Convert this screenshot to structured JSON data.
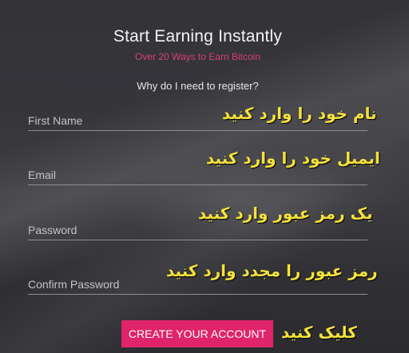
{
  "header": {
    "title": "Start Earning Instantly",
    "subtitle": "Over 20 Ways to Earn Bitcoin",
    "why_link": "Why do I need to register?"
  },
  "form": {
    "first_name": {
      "placeholder": "First Name",
      "value": ""
    },
    "email": {
      "placeholder": "Email",
      "value": ""
    },
    "password": {
      "placeholder": "Password",
      "value": ""
    },
    "confirm_password": {
      "placeholder": "Confirm Password",
      "value": ""
    },
    "submit_label": "CREATE YOUR ACCOUNT"
  },
  "annotations": {
    "first_name": "نام خود را وارد کنید",
    "email": "ایمیل خود را وارد کنید",
    "password": "یک رمز عبور وارد کنید",
    "confirm_password": "رمز عبور را مجدد وارد کنید",
    "submit": "کلیک کنید"
  },
  "colors": {
    "accent": "#e0246a",
    "subtitle": "#d93f6f",
    "annotation": "#f5e23b",
    "background": "#333338"
  }
}
